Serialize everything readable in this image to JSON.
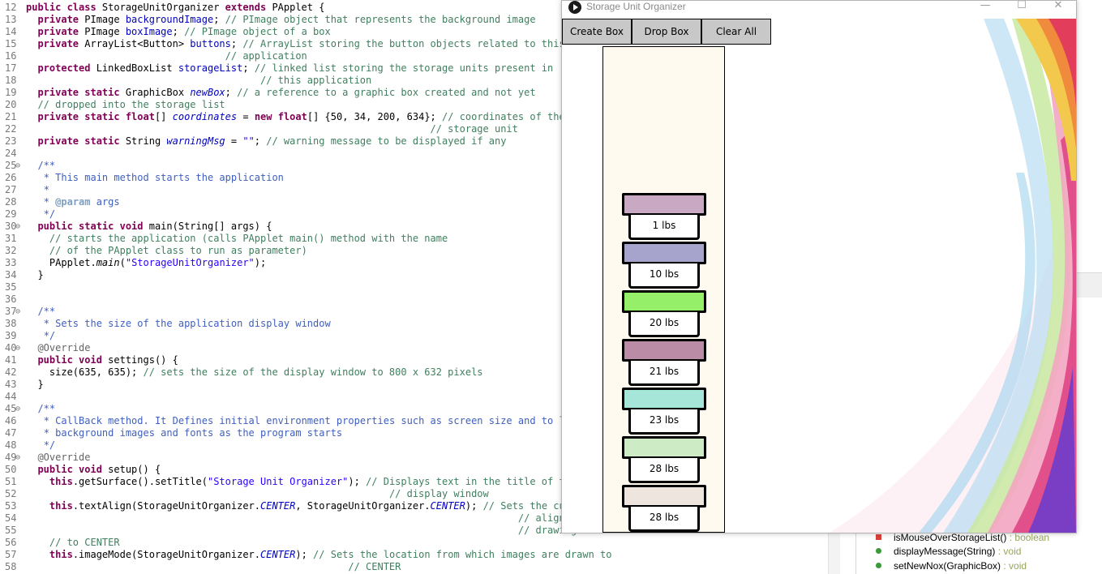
{
  "editor": {
    "lines": [
      {
        "n": "12",
        "fold": "",
        "code": [
          [
            "kw",
            "public class "
          ],
          [
            "",
            "StorageUnitOrganizer "
          ],
          [
            "kw",
            "extends "
          ],
          [
            "",
            "PApplet {"
          ]
        ]
      },
      {
        "n": "13",
        "fold": "",
        "code": [
          [
            "",
            "  "
          ],
          [
            "kw",
            "private "
          ],
          [
            "",
            "PImage "
          ],
          [
            "fld",
            "backgroundImage"
          ],
          [
            "",
            "; "
          ],
          [
            "cm",
            "// PImage object that represents the background image"
          ]
        ]
      },
      {
        "n": "14",
        "fold": "",
        "code": [
          [
            "",
            "  "
          ],
          [
            "kw",
            "private "
          ],
          [
            "",
            "PImage "
          ],
          [
            "fld",
            "boxImage"
          ],
          [
            "",
            "; "
          ],
          [
            "cm",
            "// PImage object of a box"
          ]
        ]
      },
      {
        "n": "15",
        "fold": "",
        "code": [
          [
            "",
            "  "
          ],
          [
            "kw",
            "private "
          ],
          [
            "",
            "ArrayList<Button> "
          ],
          [
            "fld",
            "buttons"
          ],
          [
            "",
            "; "
          ],
          [
            "cm",
            "// ArrayList storing the button objects related to this"
          ]
        ]
      },
      {
        "n": "16",
        "fold": "",
        "code": [
          [
            "",
            "                                  "
          ],
          [
            "cm",
            "// application"
          ]
        ]
      },
      {
        "n": "17",
        "fold": "",
        "code": [
          [
            "",
            "  "
          ],
          [
            "kw",
            "protected "
          ],
          [
            "",
            "LinkedBoxList "
          ],
          [
            "fld",
            "storageList"
          ],
          [
            "",
            "; "
          ],
          [
            "cm",
            "// linked list storing the storage units present in"
          ]
        ]
      },
      {
        "n": "18",
        "fold": "",
        "code": [
          [
            "",
            "                                        "
          ],
          [
            "cm",
            "// this application"
          ]
        ]
      },
      {
        "n": "19",
        "fold": "",
        "code": [
          [
            "",
            "  "
          ],
          [
            "kw",
            "private static "
          ],
          [
            "",
            "GraphicBox "
          ],
          [
            "sfld",
            "newBox"
          ],
          [
            "",
            "; "
          ],
          [
            "cm",
            "// a reference to a graphic box created and not yet"
          ]
        ]
      },
      {
        "n": "20",
        "fold": "",
        "code": [
          [
            "",
            "  "
          ],
          [
            "cm",
            "// dropped into the storage list"
          ]
        ]
      },
      {
        "n": "21",
        "fold": "",
        "code": [
          [
            "",
            "  "
          ],
          [
            "kw",
            "private static float"
          ],
          [
            "",
            "[] "
          ],
          [
            "sfld",
            "coordinates"
          ],
          [
            "",
            " = "
          ],
          [
            "kw",
            "new float"
          ],
          [
            "",
            "[] {50, 34, 200, 634}; "
          ],
          [
            "cm",
            "// coordinates of the"
          ]
        ]
      },
      {
        "n": "22",
        "fold": "",
        "code": [
          [
            "",
            "                                                                     "
          ],
          [
            "cm",
            "// storage unit"
          ]
        ]
      },
      {
        "n": "23",
        "fold": "",
        "code": [
          [
            "",
            "  "
          ],
          [
            "kw",
            "private static "
          ],
          [
            "",
            "String "
          ],
          [
            "sfld",
            "warningMsg"
          ],
          [
            "",
            " = "
          ],
          [
            "str",
            "\"\""
          ],
          [
            "",
            "; "
          ],
          [
            "cm",
            "// warning message to be displayed if any"
          ]
        ]
      },
      {
        "n": "24",
        "fold": "",
        "code": []
      },
      {
        "n": "25",
        "fold": "⊖",
        "code": [
          [
            "",
            "  "
          ],
          [
            "jd",
            "/**"
          ]
        ]
      },
      {
        "n": "26",
        "fold": "",
        "code": [
          [
            "",
            "   "
          ],
          [
            "jd",
            "* This main method starts the application"
          ]
        ]
      },
      {
        "n": "27",
        "fold": "",
        "code": [
          [
            "",
            "   "
          ],
          [
            "jd",
            "*"
          ]
        ]
      },
      {
        "n": "28",
        "fold": "",
        "code": [
          [
            "",
            "   "
          ],
          [
            "jd",
            "* "
          ],
          [
            "jt",
            "@param"
          ],
          [
            "jd",
            " args"
          ]
        ]
      },
      {
        "n": "29",
        "fold": "",
        "code": [
          [
            "",
            "   "
          ],
          [
            "jd",
            "*/"
          ]
        ]
      },
      {
        "n": "30",
        "fold": "⊖",
        "code": [
          [
            "",
            "  "
          ],
          [
            "kw",
            "public static void "
          ],
          [
            "",
            "main(String[] args) {"
          ]
        ]
      },
      {
        "n": "31",
        "fold": "",
        "code": [
          [
            "",
            "    "
          ],
          [
            "cm",
            "// starts the application (calls PApplet main() method with the name"
          ]
        ]
      },
      {
        "n": "32",
        "fold": "",
        "code": [
          [
            "",
            "    "
          ],
          [
            "cm",
            "// of the PApplet class to run as parameter)"
          ]
        ]
      },
      {
        "n": "33",
        "fold": "",
        "code": [
          [
            "",
            "    PApplet."
          ],
          [
            "it",
            "main"
          ],
          [
            "",
            "("
          ],
          [
            "str",
            "\"StorageUnitOrganizer\""
          ],
          [
            "",
            ");"
          ]
        ]
      },
      {
        "n": "34",
        "fold": "",
        "code": [
          [
            "",
            "  }"
          ]
        ]
      },
      {
        "n": "35",
        "fold": "",
        "code": []
      },
      {
        "n": "36",
        "fold": "",
        "code": []
      },
      {
        "n": "37",
        "fold": "⊖",
        "code": [
          [
            "",
            "  "
          ],
          [
            "jd",
            "/**"
          ]
        ]
      },
      {
        "n": "38",
        "fold": "",
        "code": [
          [
            "",
            "   "
          ],
          [
            "jd",
            "* Sets the size of the application display window"
          ]
        ]
      },
      {
        "n": "39",
        "fold": "",
        "code": [
          [
            "",
            "   "
          ],
          [
            "jd",
            "*/"
          ]
        ]
      },
      {
        "n": "40",
        "fold": "⊖",
        "code": [
          [
            "",
            "  "
          ],
          [
            "ann",
            "@Override"
          ]
        ]
      },
      {
        "n": "41",
        "fold": "",
        "code": [
          [
            "",
            "  "
          ],
          [
            "kw",
            "public void "
          ],
          [
            "",
            "settings() {"
          ]
        ]
      },
      {
        "n": "42",
        "fold": "",
        "code": [
          [
            "",
            "    size(635, 635); "
          ],
          [
            "cm",
            "// sets the size of the display window to 800 x 632 pixels"
          ]
        ]
      },
      {
        "n": "43",
        "fold": "",
        "code": [
          [
            "",
            "  }"
          ]
        ]
      },
      {
        "n": "44",
        "fold": "",
        "code": []
      },
      {
        "n": "45",
        "fold": "⊖",
        "code": [
          [
            "",
            "  "
          ],
          [
            "jd",
            "/**"
          ]
        ]
      },
      {
        "n": "46",
        "fold": "",
        "code": [
          [
            "",
            "   "
          ],
          [
            "jd",
            "* CallBack method. It Defines initial environment properties such as screen size and to load"
          ]
        ]
      },
      {
        "n": "47",
        "fold": "",
        "code": [
          [
            "",
            "   "
          ],
          [
            "jd",
            "* background images and fonts as the program starts"
          ]
        ]
      },
      {
        "n": "48",
        "fold": "",
        "code": [
          [
            "",
            "   "
          ],
          [
            "jd",
            "*/"
          ]
        ]
      },
      {
        "n": "49",
        "fold": "⊖",
        "code": [
          [
            "",
            "  "
          ],
          [
            "ann",
            "@Override"
          ]
        ]
      },
      {
        "n": "50",
        "fold": "",
        "code": [
          [
            "",
            "  "
          ],
          [
            "kw",
            "public void "
          ],
          [
            "",
            "setup() {"
          ]
        ]
      },
      {
        "n": "51",
        "fold": "",
        "code": [
          [
            "",
            "    "
          ],
          [
            "kw",
            "this"
          ],
          [
            "",
            ".getSurface().setTitle("
          ],
          [
            "str",
            "\"Storage Unit Organizer\""
          ],
          [
            "",
            "); "
          ],
          [
            "cm",
            "// Displays text in the title of the"
          ]
        ]
      },
      {
        "n": "52",
        "fold": "",
        "code": [
          [
            "",
            "                                                              "
          ],
          [
            "cm",
            "// display window"
          ]
        ]
      },
      {
        "n": "53",
        "fold": "",
        "code": [
          [
            "",
            "    "
          ],
          [
            "kw",
            "this"
          ],
          [
            "",
            ".textAlign(StorageUnitOrganizer."
          ],
          [
            "sfld",
            "CENTER"
          ],
          [
            "",
            ", StorageUnitOrganizer."
          ],
          [
            "sfld",
            "CENTER"
          ],
          [
            "",
            "); "
          ],
          [
            "cm",
            "// Sets the current"
          ]
        ]
      },
      {
        "n": "54",
        "fold": "",
        "code": [
          [
            "",
            "                                                                                    "
          ],
          [
            "cm",
            "// alignment for"
          ]
        ]
      },
      {
        "n": "55",
        "fold": "",
        "code": [
          [
            "",
            "                                                                                    "
          ],
          [
            "cm",
            "// drawing text"
          ]
        ]
      },
      {
        "n": "56",
        "fold": "",
        "code": [
          [
            "",
            "    "
          ],
          [
            "cm",
            "// to CENTER"
          ]
        ]
      },
      {
        "n": "57",
        "fold": "",
        "code": [
          [
            "",
            "    "
          ],
          [
            "kw",
            "this"
          ],
          [
            "",
            ".imageMode(StorageUnitOrganizer."
          ],
          [
            "sfld",
            "CENTER"
          ],
          [
            "",
            "); "
          ],
          [
            "cm",
            "// Sets the location from which images are drawn to"
          ]
        ]
      },
      {
        "n": "58",
        "fold": "",
        "code": [
          [
            "",
            "                                                       "
          ],
          [
            "cm",
            "// CENTER"
          ]
        ]
      }
    ]
  },
  "outline": {
    "items": [
      {
        "label": "isMouseOverStorageList()",
        "ret": " : boolean",
        "icon": "red-square-icon",
        "color": "#d9403a"
      },
      {
        "label": "displayMessage(String)",
        "ret": " : void",
        "icon": "green-dot-icon",
        "color": "#3a9a3a"
      },
      {
        "label": "setNewNox(GraphicBox)",
        "ret": " : void",
        "icon": "green-dot-static-icon",
        "color": "#3a9a3a"
      }
    ]
  },
  "app": {
    "title": "Storage Unit Organizer",
    "controls": {
      "minimize": "—",
      "maximize": "☐",
      "close": "✕"
    },
    "buttons": [
      {
        "label": "Create Box"
      },
      {
        "label": "Drop Box"
      },
      {
        "label": "Clear All"
      }
    ],
    "boxes": [
      {
        "label": "1 lbs",
        "color": "#c9a8c4"
      },
      {
        "label": "10 lbs",
        "color": "#a6a3cc"
      },
      {
        "label": "20 lbs",
        "color": "#95ef68"
      },
      {
        "label": "21 lbs",
        "color": "#bb8ca6"
      },
      {
        "label": "23 lbs",
        "color": "#a6e6d8"
      },
      {
        "label": "28 lbs",
        "color": "#cdecc5"
      },
      {
        "label": "28 lbs",
        "color": "#eee6de"
      }
    ]
  }
}
